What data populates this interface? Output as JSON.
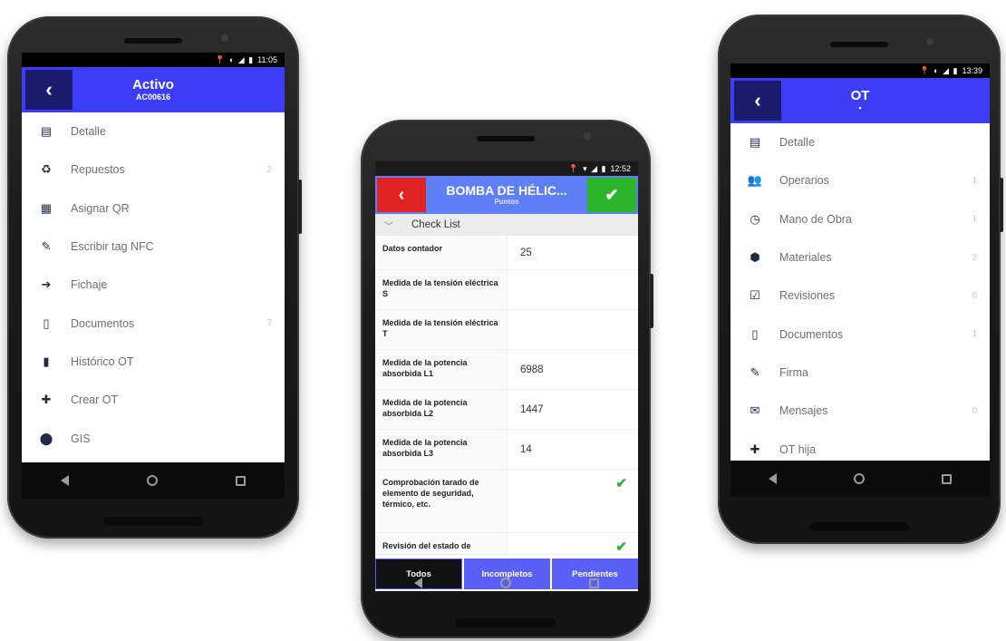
{
  "phones": {
    "left": {
      "status_time": "11:05",
      "title": "Activo",
      "subtitle": "AC00616",
      "menu": [
        {
          "icon": "list-icon",
          "glyph": "▤",
          "label": "Detalle",
          "count": ""
        },
        {
          "icon": "recycle-icon",
          "glyph": "♻",
          "label": "Repuestos",
          "count": "2"
        },
        {
          "icon": "qr-code-icon",
          "glyph": "▦",
          "label": "Asignar QR",
          "count": ""
        },
        {
          "icon": "edit-icon",
          "glyph": "✎",
          "label": "Escribir tag NFC",
          "count": ""
        },
        {
          "icon": "sign-in-icon",
          "glyph": "➔",
          "label": "Fichaje",
          "count": ""
        },
        {
          "icon": "document-icon",
          "glyph": "▯",
          "label": "Documentos",
          "count": "7"
        },
        {
          "icon": "bookmark-icon",
          "glyph": "▮",
          "label": "Histórico OT",
          "count": ""
        },
        {
          "icon": "plus-icon",
          "glyph": "✚",
          "label": "Crear OT",
          "count": ""
        },
        {
          "icon": "map-marker-icon",
          "glyph": "⬤",
          "label": "GIS",
          "count": ""
        }
      ]
    },
    "middle": {
      "status_time": "12:52",
      "title": "BOMBA DE HÉLIC...",
      "subtitle": "Puntos",
      "section": "Check List",
      "rows": [
        {
          "question": "Datos contador",
          "answer": "25",
          "checked": false
        },
        {
          "question": "Medida de la tensión eléctrica S",
          "answer": "",
          "checked": false
        },
        {
          "question": "Medida de la tensión eléctrica T",
          "answer": "",
          "checked": false
        },
        {
          "question": "Medida de la potencia absorbida L1",
          "answer": "6988",
          "checked": false
        },
        {
          "question": "Medida de la potencia absorbida L2",
          "answer": "1447",
          "checked": false
        },
        {
          "question": "Medida de la potencia absorbida L3",
          "answer": "14",
          "checked": false
        },
        {
          "question": "Comprobación tarado de elemento de seguridad, térmico, etc.",
          "answer": "",
          "checked": true
        },
        {
          "question": "Revisión del estado de",
          "answer": "",
          "checked": true
        }
      ],
      "filters": {
        "all": "Todos",
        "incomplete": "Incompletos",
        "pending": "Pendientes"
      }
    },
    "right": {
      "status_time": "13:39",
      "title": "OT",
      "subtitle": "•",
      "menu": [
        {
          "icon": "list-icon",
          "glyph": "▤",
          "label": "Detalle",
          "count": ""
        },
        {
          "icon": "users-icon",
          "glyph": "👥",
          "label": "Operarios",
          "count": "1"
        },
        {
          "icon": "clock-icon",
          "glyph": "◷",
          "label": "Mano de Obra",
          "count": "1"
        },
        {
          "icon": "cube-icon",
          "glyph": "⬢",
          "label": "Materiales",
          "count": "2"
        },
        {
          "icon": "checkbox-icon",
          "glyph": "☑",
          "label": "Revisiones",
          "count": "0"
        },
        {
          "icon": "document-icon",
          "glyph": "▯",
          "label": "Documentos",
          "count": "1"
        },
        {
          "icon": "signature-icon",
          "glyph": "✎",
          "label": "Firma",
          "count": ""
        },
        {
          "icon": "envelope-icon",
          "glyph": "✉",
          "label": "Mensajes",
          "count": "0"
        },
        {
          "icon": "plus-icon",
          "glyph": "✚",
          "label": "OT hija",
          "count": ""
        }
      ]
    }
  },
  "colors": {
    "appbar": "#3d3df5",
    "back_button": "#1c1c6e",
    "mid_appbar": "#5f7ff7",
    "red_button": "#e02424",
    "green_button": "#2bb52b",
    "filter_active": "#111111",
    "filter_inactive": "#5a5ff5"
  }
}
